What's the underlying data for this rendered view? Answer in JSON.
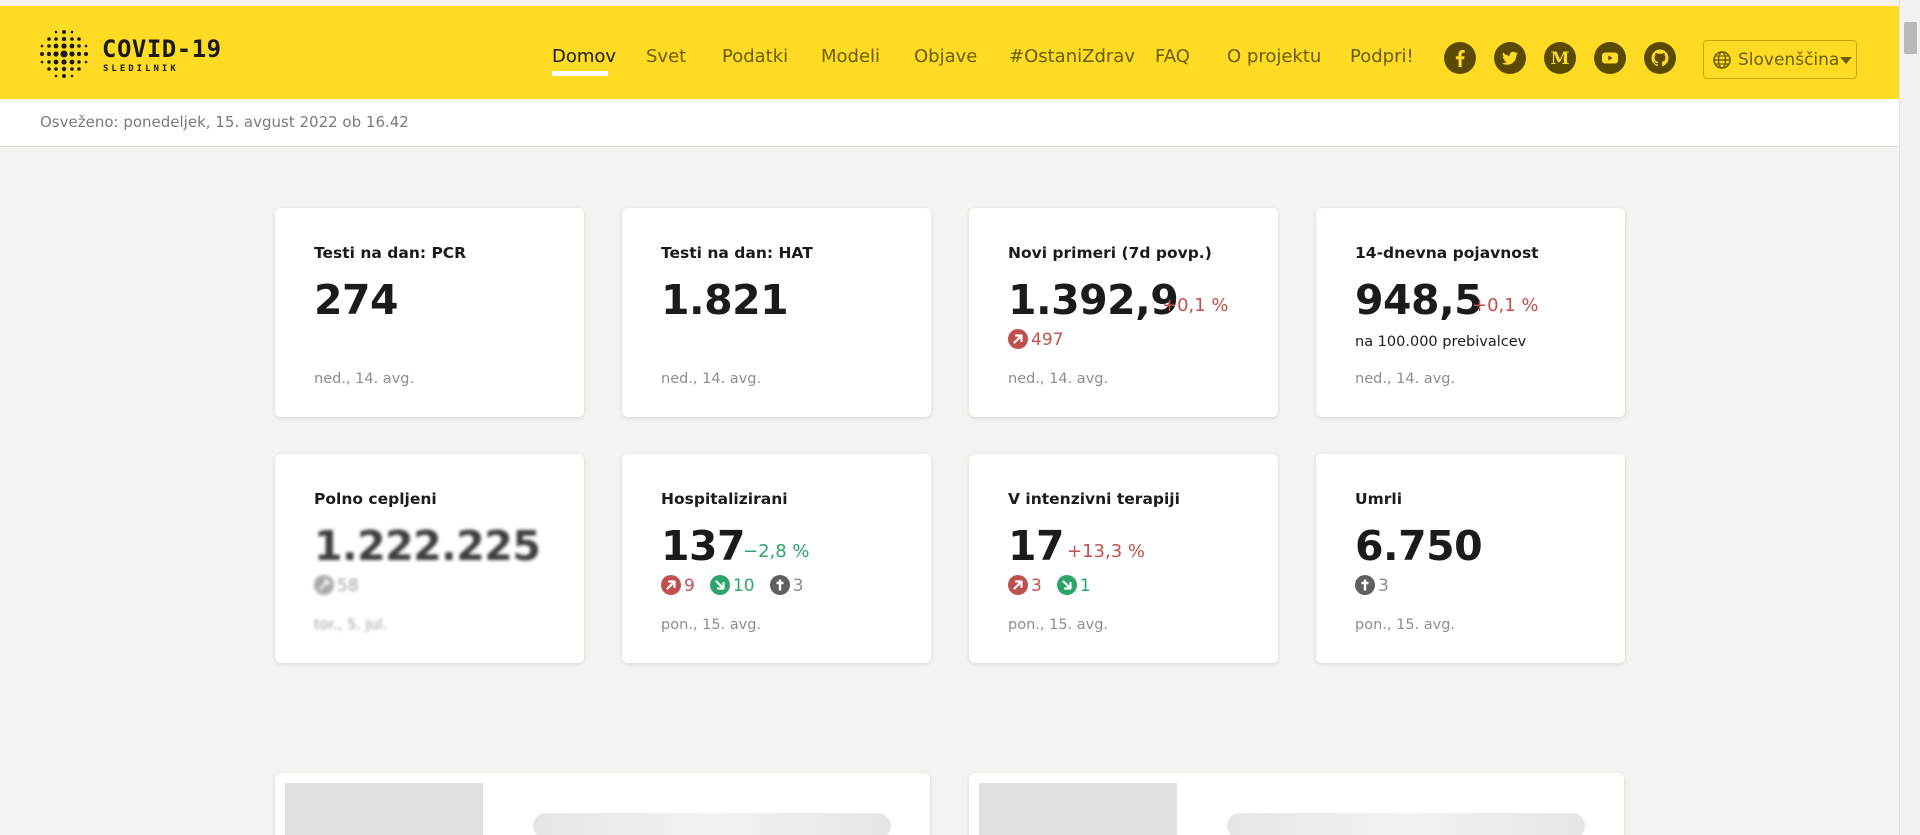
{
  "brand": {
    "title": "COVID-19",
    "subtitle": "SLEDILNIK"
  },
  "nav": {
    "items": [
      {
        "label": "Domov",
        "active": true
      },
      {
        "label": "Svet"
      },
      {
        "label": "Podatki"
      },
      {
        "label": "Modeli"
      },
      {
        "label": "Objave"
      },
      {
        "label": "#OstaniZdrav"
      },
      {
        "label": "FAQ"
      },
      {
        "label": "O projektu"
      },
      {
        "label": "Podpri!"
      }
    ],
    "social_icons": [
      "facebook-icon",
      "twitter-icon",
      "medium-icon",
      "youtube-icon",
      "github-icon"
    ],
    "language": "Slovenščina"
  },
  "updated": "Osveženo: ponedeljek, 15. avgust 2022 ob 16.42",
  "colors": {
    "brand_yellow": "#ffdb24",
    "increase": "#c0504d",
    "decrease": "#2ba56a",
    "deaths": "#5f5f5f"
  },
  "cards": [
    {
      "title": "Testi na dan: PCR",
      "value": "274",
      "date": "ned., 14. avg."
    },
    {
      "title": "Testi na dan: HAT",
      "value": "1.821",
      "date": "ned., 14. avg."
    },
    {
      "title": "Novi primeri (7d povp.)",
      "value": "1.392,9",
      "delta": "+0,1 %",
      "stat_up": "497",
      "date": "ned., 14. avg."
    },
    {
      "title": "14-dnevna pojavnost",
      "value": "948,5",
      "delta": "+0,1 %",
      "sub": "na 100.000 prebivalcev",
      "date": "ned., 14. avg."
    },
    {
      "title": "Polno cepljeni",
      "value": "1.222.225",
      "stat": "58",
      "date": "tor., 5. jul."
    },
    {
      "title": "Hospitalizirani",
      "value": "137",
      "delta": "−2,8 %",
      "stat_up": "9",
      "stat_down": "10",
      "stat_dead": "3",
      "date": "pon., 15. avg."
    },
    {
      "title": "V intenzivni terapiji",
      "value": "17",
      "delta": "+13,3 %",
      "stat_up": "3",
      "stat_down": "1",
      "date": "pon., 15. avg."
    },
    {
      "title": "Umrli",
      "value": "6.750",
      "stat_dead": "3",
      "date": "pon., 15. avg."
    }
  ]
}
